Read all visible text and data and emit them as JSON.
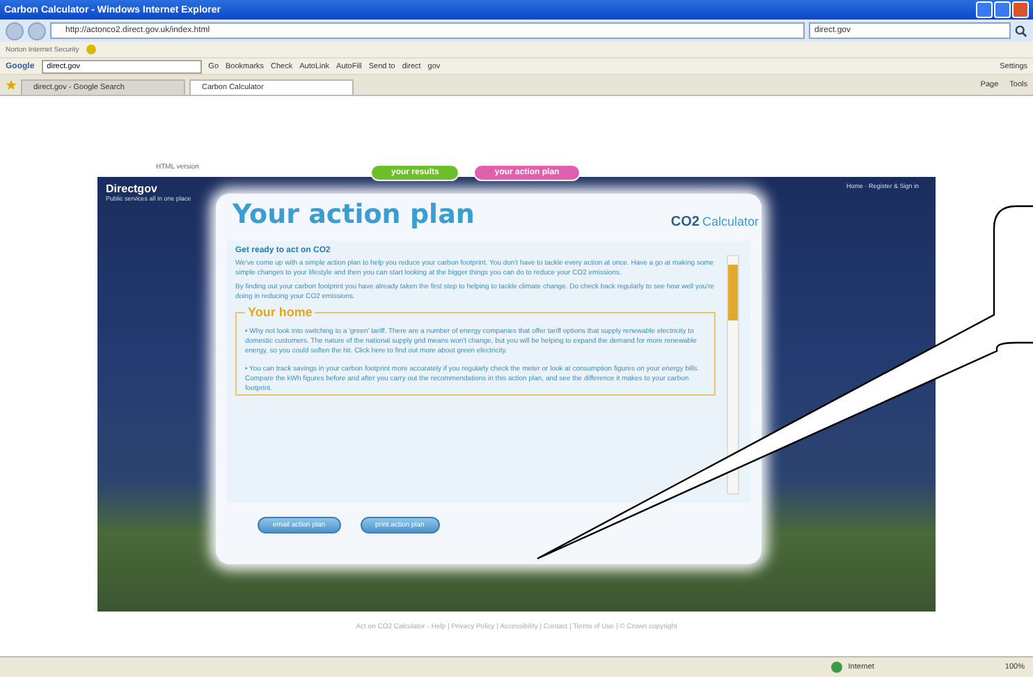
{
  "window": {
    "title": "Carbon Calculator - Windows Internet Explorer"
  },
  "address_bar": {
    "url": "http://actonco2.direct.gov.uk/index.html",
    "search_value": "direct.gov"
  },
  "links_bar": {
    "label": "Norton Internet Security"
  },
  "google_toolbar": {
    "label": "Google",
    "search_value": "direct.gov",
    "items": [
      "Go",
      "Bookmarks",
      "Check",
      "AutoLink",
      "AutoFill",
      "Send to",
      "direct",
      "gov"
    ],
    "settings": "Settings"
  },
  "tabs": [
    {
      "label": "direct.gov - Google Search",
      "selected": false
    },
    {
      "label": "Carbon Calculator",
      "selected": true
    }
  ],
  "command_bar": {
    "items": [
      "Page",
      "Tools"
    ]
  },
  "page": {
    "html_link": "HTML version",
    "site_name": "Directgov",
    "site_tagline": "Public services all in one place",
    "nav_tabs": [
      {
        "label": "your results",
        "selected": false
      },
      {
        "label": "your action plan",
        "selected": true
      }
    ],
    "top_links": "Home · Register & Sign in",
    "heading": "Your action plan",
    "logo_text": "Calculator",
    "logo_mark": "CO2",
    "intro_title": "Get ready to act on CO2",
    "paragraphs": [
      "We've come up with a simple action plan to help you reduce your carbon footprint. You don't have to tackle every action at once. Have a go at making some simple changes to your lifestyle and then you can start looking at the bigger things you can do to reduce your CO2 emissions.",
      "By finding out your carbon footprint you have already taken the first step to helping to tackle climate change. Do check back regularly to see how well you're doing in reducing your CO2 emissions."
    ],
    "section_title": "Your home",
    "bullets": [
      "• Why not look into switching to a 'green' tariff. There are a number of energy companies that offer tariff options that supply renewable electricity to domestic customers. The nature of the national supply grid means won't change, but you will be helping to expand the demand for more renewable energy, so you could soften the hit. Click here to find out more about green electricity.",
      "• You can track savings in your carbon footprint more accurately if you regularly check the meter or look at consumption figures on your energy bills. Compare the kWh figures before and after you carry out the recommendations in this action plan, and see the difference it makes to your carbon footprint."
    ],
    "buttons": [
      "email action plan",
      "print action plan"
    ],
    "footer": "Act on CO2 Calculator - Help  |  Privacy Policy  |  Accessibility  |  Contact  |  Terms of Use  |  © Crown copyright"
  },
  "status_bar": {
    "zone": "Internet",
    "zoom": "100%"
  }
}
